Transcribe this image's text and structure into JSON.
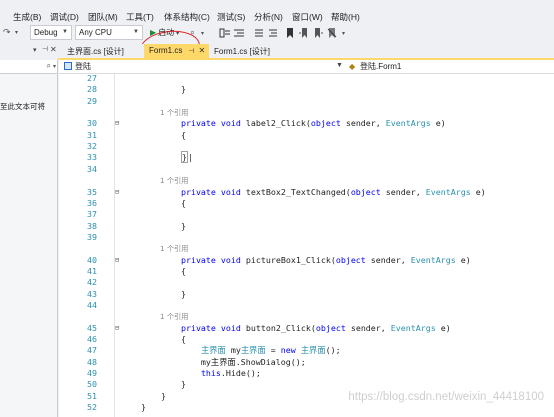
{
  "menu": [
    "生成(B)",
    "调试(D)",
    "团队(M)",
    "工具(T)",
    "体系结构(C)",
    "测试(S)",
    "分析(N)",
    "窗口(W)",
    "帮助(H)"
  ],
  "toolbar": {
    "config": "Debug",
    "platform": "Any CPU",
    "start_label": "启动"
  },
  "tabs": [
    {
      "label": "主界面.cs [设计]",
      "active": false
    },
    {
      "label": "Form1.cs",
      "active": true
    },
    {
      "label": "Form1.cs [设计]",
      "active": false
    }
  ],
  "left_panel": {
    "text": "至此文本可将"
  },
  "nav": {
    "left": "登陆",
    "right": "登陆.Form1"
  },
  "code_lines": [
    {
      "n": "27",
      "code": ""
    },
    {
      "n": "28",
      "code": "            }"
    },
    {
      "n": "29",
      "code": ""
    },
    {
      "n": "",
      "hint": "1 个引用"
    },
    {
      "n": "30",
      "fold": "⊟",
      "code": "            private void label2_Click(object sender, EventArgs e)"
    },
    {
      "n": "31",
      "code": "            {"
    },
    {
      "n": "32",
      "code": ""
    },
    {
      "n": "33",
      "code": "            }"
    },
    {
      "n": "34",
      "code": ""
    },
    {
      "n": "",
      "hint": "1 个引用"
    },
    {
      "n": "35",
      "fold": "⊟",
      "code": "            private void textBox2_TextChanged(object sender, EventArgs e)"
    },
    {
      "n": "36",
      "code": "            {"
    },
    {
      "n": "37",
      "code": ""
    },
    {
      "n": "38",
      "code": "            }"
    },
    {
      "n": "39",
      "code": ""
    },
    {
      "n": "",
      "hint": "1 个引用"
    },
    {
      "n": "40",
      "fold": "⊟",
      "code": "            private void pictureBox1_Click(object sender, EventArgs e)"
    },
    {
      "n": "41",
      "code": "            {"
    },
    {
      "n": "42",
      "code": ""
    },
    {
      "n": "43",
      "code": "            }"
    },
    {
      "n": "44",
      "code": ""
    },
    {
      "n": "",
      "hint": "1 个引用"
    },
    {
      "n": "45",
      "fold": "⊟",
      "code": "            private void button2_Click(object sender, EventArgs e)"
    },
    {
      "n": "46",
      "code": "            {"
    },
    {
      "n": "47",
      "code": "                主界面 my主界面 = new 主界面();"
    },
    {
      "n": "48",
      "code": "                my主界面.ShowDialog();"
    },
    {
      "n": "49",
      "code": "                this.Hide();"
    },
    {
      "n": "50",
      "code": "            }"
    },
    {
      "n": "51",
      "code": "        }"
    },
    {
      "n": "52",
      "code": "    }"
    }
  ],
  "watermark": "https://blog.csdn.net/weixin_44418100",
  "colors": {
    "keyword": "#0000ff",
    "type": "#2b91af",
    "active_tab": "#ffd86a",
    "annotation_circle": "#d9262c"
  }
}
